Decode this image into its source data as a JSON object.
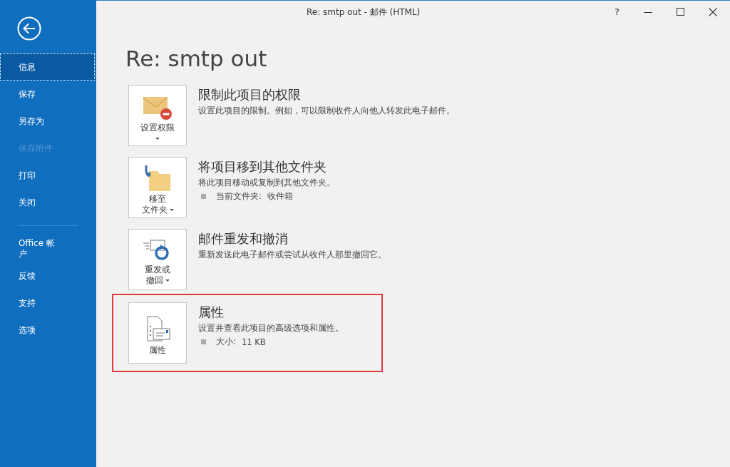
{
  "window": {
    "title": "Re: smtp out  -  邮件 (HTML)",
    "help": "?"
  },
  "sidebar": {
    "groups": [
      [
        {
          "label": "信息",
          "selected": true,
          "disabled": false
        },
        {
          "label": "保存",
          "selected": false,
          "disabled": false
        },
        {
          "label": "另存为",
          "selected": false,
          "disabled": false
        },
        {
          "label": "保存附件",
          "selected": false,
          "disabled": true
        },
        {
          "label": "打印",
          "selected": false,
          "disabled": false
        },
        {
          "label": "关闭",
          "selected": false,
          "disabled": false
        }
      ],
      [
        {
          "label": "Office 帐户",
          "selected": false,
          "disabled": false
        },
        {
          "label": "反馈",
          "selected": false,
          "disabled": false
        },
        {
          "label": "支持",
          "selected": false,
          "disabled": false
        },
        {
          "label": "选项",
          "selected": false,
          "disabled": false
        }
      ]
    ]
  },
  "page_title": "Re: smtp out",
  "sections": [
    {
      "kind": "permission",
      "button_lines": [
        "设置权限"
      ],
      "dropdown": true,
      "title": "限制此项目的权限",
      "description": "设置此项目的限制。例如，可以限制收件人向他人转发此电子邮件。",
      "highlighted": false
    },
    {
      "kind": "move",
      "button_lines": [
        "移至",
        "文件夹"
      ],
      "dropdown": true,
      "title": "将项目移到其他文件夹",
      "description": "将此项目移动或复制到其他文件夹。",
      "details": [
        {
          "label": "当前文件夹:",
          "value": "收件箱"
        }
      ],
      "highlighted": false
    },
    {
      "kind": "resend",
      "button_lines": [
        "重发或",
        "撤回"
      ],
      "dropdown": true,
      "title": "邮件重发和撤消",
      "description": "重新发送此电子邮件或尝试从收件人那里撤回它。",
      "highlighted": false
    },
    {
      "kind": "properties",
      "button_lines": [
        "属性"
      ],
      "title": "属性",
      "description": "设置并查看此项目的高级选项和属性。",
      "details": [
        {
          "label": "大小:",
          "value": "11 KB"
        }
      ],
      "highlighted": true
    }
  ]
}
